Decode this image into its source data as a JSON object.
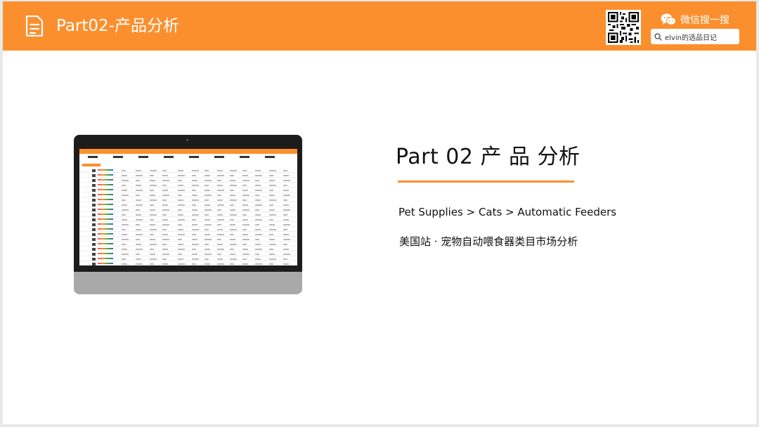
{
  "header": {
    "title": "Part02-产品分析",
    "wechat_label": "微信搜一搜",
    "search_text": "elvin的选品日记"
  },
  "main": {
    "part_title": "Part 02  产 品 分析",
    "breadcrumb": "Pet Supplies > Cats > Automatic Feeders",
    "subtitle": "美国站 · 宠物自动喂食器类目市场分析"
  },
  "icons": {
    "document": "document-icon",
    "wechat": "wechat-icon",
    "search": "search-icon",
    "qr": "qr-code-icon"
  },
  "colors": {
    "accent": "#fb8f2e",
    "text": "#111111",
    "laptop_bezel": "#1c1c1c",
    "laptop_base": "#a9a9a9"
  }
}
